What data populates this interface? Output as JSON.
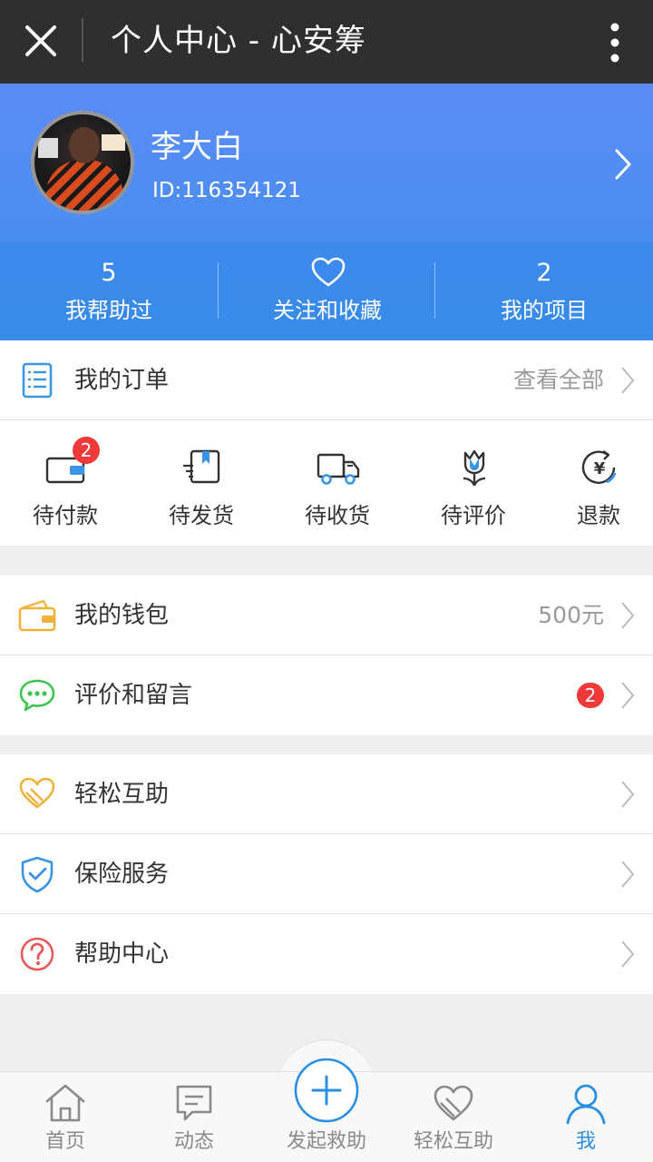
{
  "topbar": {
    "title": "个人中心 - 心安筹",
    "close_icon": "close-icon",
    "more_icon": "more-vertical-icon"
  },
  "profile": {
    "name": "李大白",
    "id": "ID:116354121"
  },
  "stats": [
    {
      "value": "5",
      "label": "我帮助过"
    },
    {
      "label": "关注和收藏",
      "icon": "heart-icon"
    },
    {
      "value": "2",
      "label": "我的项目"
    }
  ],
  "orders": {
    "title": "我的订单",
    "view_all": "查看全部",
    "items": [
      {
        "label": "待付款",
        "icon": "wallet-card-icon",
        "badge": "2"
      },
      {
        "label": "待发货",
        "icon": "shipping-box-icon"
      },
      {
        "label": "待收货",
        "icon": "delivery-truck-icon"
      },
      {
        "label": "待评价",
        "icon": "flower-icon"
      },
      {
        "label": "退款",
        "icon": "yen-refund-icon"
      }
    ]
  },
  "wallet": {
    "label": "我的钱包",
    "value": "500元"
  },
  "comments": {
    "label": "评价和留言",
    "badge": "2"
  },
  "mutual_aid": {
    "label": "轻松互助"
  },
  "insurance": {
    "label": "保险服务"
  },
  "help": {
    "label": "帮助中心"
  },
  "tabs": [
    {
      "label": "首页",
      "icon": "home-icon"
    },
    {
      "label": "动态",
      "icon": "chat-icon"
    },
    {
      "label": "发起救助",
      "icon": "plus-circle-icon"
    },
    {
      "label": "轻松互助",
      "icon": "heart-hands-icon"
    },
    {
      "label": "我",
      "icon": "user-icon",
      "active": true
    }
  ],
  "colors": {
    "accent": "#2a8fe0",
    "badge": "#f03a3a",
    "topbar": "#2f2f2f",
    "header_gradient_start": "#5b8cf5"
  }
}
